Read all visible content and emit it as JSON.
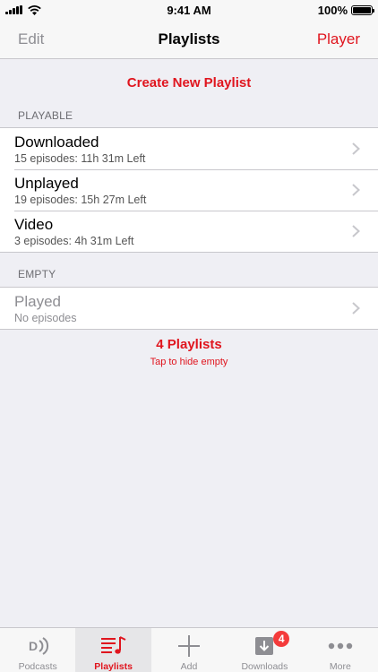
{
  "status_bar": {
    "time": "9:41 AM",
    "battery": "100%",
    "battery_level": 1.0
  },
  "nav": {
    "edit_label": "Edit",
    "title": "Playlists",
    "player_label": "Player"
  },
  "create_label": "Create New Playlist",
  "sections": [
    {
      "header": "PLAYABLE",
      "rows": [
        {
          "title": "Downloaded",
          "subtitle": "15 episodes: 11h 31m Left"
        },
        {
          "title": "Unplayed",
          "subtitle": "19 episodes: 15h 27m Left"
        },
        {
          "title": "Video",
          "subtitle": "3 episodes: 4h 31m Left"
        }
      ]
    },
    {
      "header": "EMPTY",
      "rows": [
        {
          "title": "Played",
          "subtitle": "No episodes"
        }
      ]
    }
  ],
  "summary": {
    "count": "4 Playlists",
    "hint": "Tap to hide empty"
  },
  "tabs": [
    {
      "label": "Podcasts",
      "icon": "podcasts-icon"
    },
    {
      "label": "Playlists",
      "icon": "playlists-icon",
      "active": true
    },
    {
      "label": "Add",
      "icon": "add-icon"
    },
    {
      "label": "Downloads",
      "icon": "downloads-icon",
      "badge": "4"
    },
    {
      "label": "More",
      "icon": "more-icon"
    }
  ],
  "colors": {
    "accent": "#e0151e",
    "background": "#efeff4",
    "badge": "#f43b3b"
  }
}
